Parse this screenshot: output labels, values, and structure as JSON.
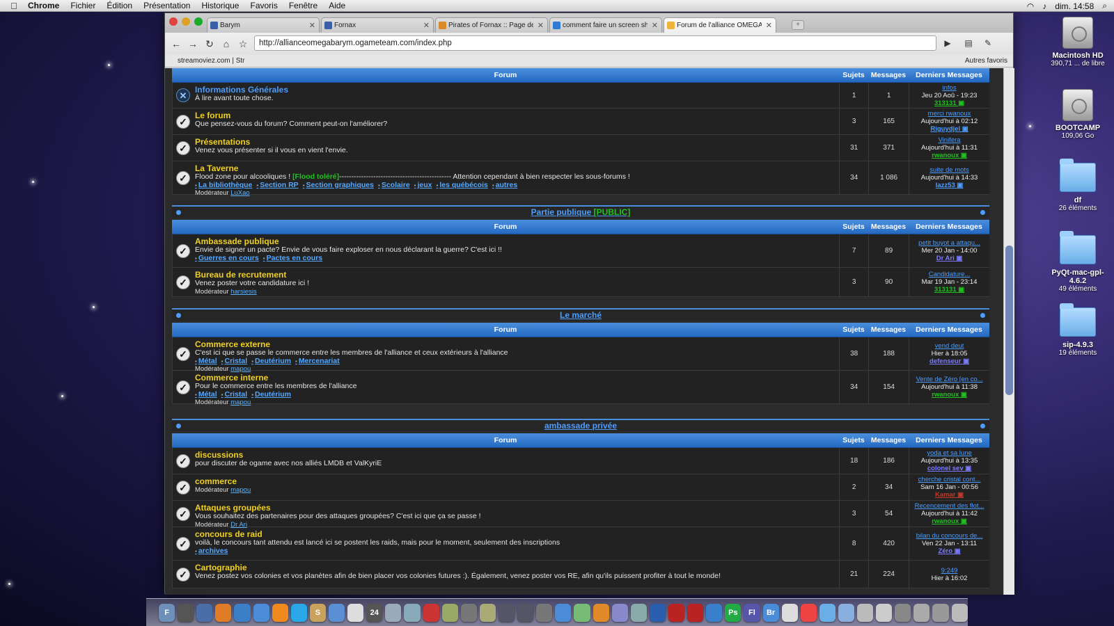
{
  "menubar": {
    "app": "Chrome",
    "items": [
      "Fichier",
      "Édition",
      "Présentation",
      "Historique",
      "Favoris",
      "Fenêtre",
      "Aide"
    ],
    "clock": "dim. 14:58"
  },
  "desktop": [
    {
      "name": "Macintosh HD",
      "info": "390,71 ... de libre",
      "kind": "drive"
    },
    {
      "name": "BOOTCAMP",
      "info": "109,06 Go",
      "kind": "drive"
    },
    {
      "name": "df",
      "info": "26 éléments",
      "kind": "folder"
    },
    {
      "name": "PyQt-mac-gpl-4.6.2",
      "info": "49 éléments",
      "kind": "folder"
    },
    {
      "name": "sip-4.9.3",
      "info": "19 éléments",
      "kind": "folder"
    }
  ],
  "browser": {
    "tabs": [
      "Barym",
      "Fornax",
      "Pirates of Fornax :: Page de l",
      "comment faire un screen sh",
      "Forum de l'alliance OMEGA"
    ],
    "url": "http://allianceomegabarym.ogameteam.com/index.php",
    "bookmark": "streamoviez.com | Str",
    "other_bookmarks": "Autres favoris"
  },
  "headers": {
    "forum": "Forum",
    "sujets": "Sujets",
    "messages": "Messages",
    "derniers": "Derniers Messages"
  },
  "moderator_label": "Modérateur",
  "sections": [
    {
      "title": "Partie publique",
      "tag": "[PUBLIC]"
    },
    {
      "title": "Le marché",
      "tag": ""
    },
    {
      "title": "ambassade privée",
      "tag": ""
    }
  ],
  "groups": [
    {
      "forums": [
        {
          "title": "Informations Générales",
          "desc": "À lire avant toute chose.",
          "subs": [],
          "mod": "",
          "topics": "1",
          "posts": "1",
          "lp_title": "infos",
          "lp_date": "Jeu 20 Aoû - 19:23",
          "lp_user": "313131",
          "lp_color": "#21c21f",
          "locked": true
        },
        {
          "title": "Le forum",
          "desc": "Que pensez-vous du forum? Comment peut-on l'améliorer?",
          "subs": [],
          "mod": "",
          "topics": "3",
          "posts": "165",
          "lp_title": "merci rwanoux",
          "lp_date": "Aujourd'hui à 02:12",
          "lp_user": "Riguydjel",
          "lp_color": "#4d9dff"
        },
        {
          "title": "Présentations",
          "desc": "Venez vous présenter si il vous en vient l'envie.",
          "subs": [],
          "mod": "",
          "topics": "31",
          "posts": "371",
          "lp_title": "Vinifera",
          "lp_date": "Aujourd'hui à 11:31",
          "lp_user": "rwanoux",
          "lp_color": "#21c21f"
        },
        {
          "title": "La Taverne",
          "desc": "Flood zone pour alcooliques ! ",
          "desc_green": "[Flood toléré]",
          "desc2": "---------------------------------------------- Attention cependant à bien respecter les sous-forums !",
          "subs": [
            "La bibliothèque",
            "Section RP",
            "Section graphiques",
            "Scolaire",
            "jeux",
            "les québécois",
            "autres"
          ],
          "mod": "LuXao",
          "topics": "34",
          "posts": "1 086",
          "lp_title": "suite de mots",
          "lp_date": "Aujourd'hui à 14:33",
          "lp_user": "lazz53",
          "lp_color": "#4d9dff"
        }
      ]
    },
    {
      "forums": [
        {
          "title": "Ambassade publique",
          "desc": "Envie de signer un pacte? Envie de vous faire exploser en nous déclarant la guerre? C'est ici !!",
          "subs": [
            "Guerres en cours",
            "Pactes en cours"
          ],
          "mod": "",
          "topics": "7",
          "posts": "89",
          "lp_title": "petit buyot a attaqu...",
          "lp_date": "Mer 20 Jan - 14:00",
          "lp_user": "Dr Ari",
          "lp_color": "#7b7bff"
        },
        {
          "title": "Bureau de recrutement",
          "desc": "Venez poster votre candidature ici !",
          "subs": [],
          "mod": "harsiesis",
          "topics": "3",
          "posts": "90",
          "lp_title": "Candidature...",
          "lp_date": "Mar 19 Jan - 23:14",
          "lp_user": "313131",
          "lp_color": "#21c21f"
        }
      ]
    },
    {
      "forums": [
        {
          "title": "Commerce externe",
          "desc": "C'est ici que se passe le commerce entre les membres de l'alliance et ceux extérieurs à l'alliance",
          "subs": [
            "Métal",
            "Cristal",
            "Deutérium",
            "Mercenariat"
          ],
          "mod": "mapou",
          "topics": "38",
          "posts": "188",
          "lp_title": "vend deut",
          "lp_date": "Hier à 18:05",
          "lp_user": "defenseur",
          "lp_color": "#7b7bff"
        },
        {
          "title": "Commerce interne",
          "desc": "Pour le commerce entre les membres de l'alliance",
          "subs": [
            "Métal",
            "Cristal",
            "Deutérium"
          ],
          "mod": "mapou",
          "topics": "34",
          "posts": "154",
          "lp_title": "Vente de Zéro [en co...",
          "lp_date": "Aujourd'hui à 11:38",
          "lp_user": "rwanoux",
          "lp_color": "#21c21f"
        }
      ]
    },
    {
      "forums": [
        {
          "title": "discussions",
          "desc": "pour discuter de ogame avec nos alliés LMDB et ValKyriE",
          "subs": [],
          "mod": "",
          "topics": "18",
          "posts": "186",
          "lp_title": "yoda et sa lune",
          "lp_date": "Aujourd'hui à 13:35",
          "lp_user": "colonel sev",
          "lp_color": "#7b7bff"
        },
        {
          "title": "commerce",
          "desc": "",
          "subs": [],
          "mod": "mapou",
          "topics": "2",
          "posts": "34",
          "lp_title": "cherche cristal cont...",
          "lp_date": "Sam 16 Jan - 00:56",
          "lp_user": "Kamar",
          "lp_color": "#c0392b"
        },
        {
          "title": "Attaques groupées",
          "desc": "Vous souhaitez des partenaires pour des attaques groupées? C'est ici que ça se passe !",
          "subs": [],
          "mod": "Dr Ari",
          "topics": "3",
          "posts": "54",
          "lp_title": "Recencement des flot...",
          "lp_date": "Aujourd'hui à 11:42",
          "lp_user": "rwanoux",
          "lp_color": "#21c21f"
        },
        {
          "title": "concours de raid",
          "desc": "voilà, le concours tant attendu est lancé ici se postent les raids, mais pour le moment, seulement des inscriptions",
          "subs": [
            "archives"
          ],
          "mod": "",
          "topics": "8",
          "posts": "420",
          "lp_title": "bilan du concours de...",
          "lp_date": "Ven 22 Jan - 13:11",
          "lp_user": "Zéro",
          "lp_color": "#7b7bff"
        },
        {
          "title": "Cartographie",
          "desc": "Venez postez vos colonies et vos planètes afin de bien placer vos colonies futures :). Également, venez poster vos RE, afin qu'ils puissent profiter à tout le monde!",
          "subs": [],
          "mod": "",
          "topics": "21",
          "posts": "224",
          "lp_title": "9:249",
          "lp_date": "Hier à 16:02",
          "lp_user": "",
          "lp_color": "#4d9dff"
        }
      ]
    }
  ],
  "dock": [
    "F",
    "",
    "",
    "",
    "",
    "",
    "",
    "",
    "S",
    "",
    "",
    "24",
    "",
    "",
    "",
    "",
    "",
    "",
    "",
    "",
    "",
    "",
    "",
    "",
    "",
    "",
    "",
    "",
    "",
    "",
    "Ps",
    "Fl",
    "Br",
    "",
    "",
    "",
    "",
    "",
    "",
    "",
    "",
    "",
    ""
  ]
}
